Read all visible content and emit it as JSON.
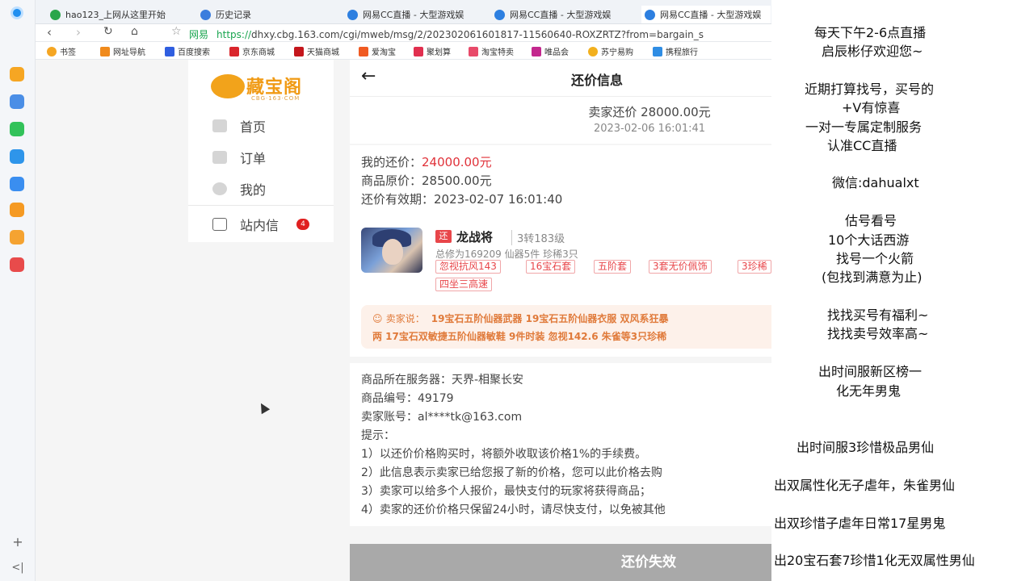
{
  "browser": {
    "tabs": [
      {
        "label": "hao123_上网从这里开始",
        "color": "#2aa64b"
      },
      {
        "label": "历史记录",
        "color": "#3b7ddd"
      },
      {
        "label": "网易CC直播 - 大型游戏娱",
        "color": "#2d7fe0"
      },
      {
        "label": "网易CC直播 - 大型游戏娱",
        "color": "#2d7fe0"
      },
      {
        "label": "网易CC直播 - 大型游戏娱",
        "color": "#2d7fe0"
      }
    ],
    "address": {
      "site": "网易",
      "protocol": "https://",
      "rest": "dhxy.cbg.163.com/cgi/mweb/msg/2/202302061601817-11560640-ROXZRTZ?from=bargain_s"
    },
    "bookmarks": [
      {
        "label": "书签",
        "color": "#f5a623"
      },
      {
        "label": "网址导航",
        "color": "#f08a1c"
      },
      {
        "label": "百度搜索",
        "color": "#2f5ee0"
      },
      {
        "label": "京东商城",
        "color": "#d9262c"
      },
      {
        "label": "天猫商城",
        "color": "#c4161c"
      },
      {
        "label": "爱淘宝",
        "color": "#f05a22"
      },
      {
        "label": "聚划算",
        "color": "#e12f4f"
      },
      {
        "label": "淘宝特卖",
        "color": "#e84a6a"
      },
      {
        "label": "唯品会",
        "color": "#c3288e"
      },
      {
        "label": "苏宁易购",
        "color": "#f2b01e"
      },
      {
        "label": "携程旅行",
        "color": "#2f8de4"
      }
    ]
  },
  "leftpanel": {
    "logo_text": "藏宝阁",
    "logo_sub": "CBG·163·COM",
    "menu": [
      {
        "label": "首页"
      },
      {
        "label": "订单"
      },
      {
        "label": "我的"
      }
    ],
    "mail_label": "站内信",
    "mail_badge": "4"
  },
  "header": {
    "back_icon": "←",
    "title": "还价信息"
  },
  "offer": {
    "price_label": "卖家还价 28000.00元",
    "time": "2023-02-06 16:01:41"
  },
  "details": {
    "my_offer_label": "我的还价：",
    "my_offer_value": "24000.00元",
    "orig_price": "商品原价：28500.00元",
    "expire": "还价有效期：2023-02-07 16:01:40"
  },
  "role": {
    "tag": "还",
    "name": "龙战将",
    "level": "3转183级",
    "stats": "总修为169209  仙器5件  珍稀3只",
    "tags": [
      "忽视抗风143",
      "16宝石套",
      "五阶套",
      "3套无价佩饰",
      "3珍稀",
      "四坐三高速"
    ]
  },
  "seller_say": {
    "label": "卖家说：",
    "line1": "19宝石五阶仙器武器 19宝石五阶仙器衣服 双风系狂暴",
    "line2": "两 17宝石双敏捷五阶仙器敏鞋 9件时装 忽视142.6 朱雀等3只珍稀"
  },
  "info": {
    "server": "商品所在服务器：天界-相聚长安",
    "id": "商品编号：49179",
    "account": "卖家账号：al****tk@163.com",
    "tips_title": "提示：",
    "tips": [
      "1）以还价价格购买时，将额外收取该价格1%的手续费。",
      "2）此信息表示卖家已给您报了新的价格，您可以此价格去购",
      "3）卖家可以给多个人报价，最快支付的玩家将获得商品；",
      "4）卖家的还价价格只保留24小时，请尽快支付，以免被其他"
    ]
  },
  "button": {
    "fail": "还价失效"
  },
  "overlay": {
    "lines": [
      "每天下午2-6点直播",
      "启辰彬仔欢迎您~",
      "近期打算找号，买号的",
      "+V有惊喜",
      "一对一专属定制服务",
      "认准CC直播",
      "微信:dahualxt",
      "估号看号",
      "10个大话西游",
      "找号一个火箭",
      "(包找到满意为止)",
      "找找买号有福利~",
      "找找卖号效率高~",
      "出时间服新区榜一",
      "化无年男鬼",
      "出时间服3珍惜极品男仙",
      "出双属性化无子虐年，朱雀男仙",
      "出双珍惜子虐年日常17星男鬼",
      "出20宝石套7珍惜1化无双属性男仙"
    ]
  }
}
